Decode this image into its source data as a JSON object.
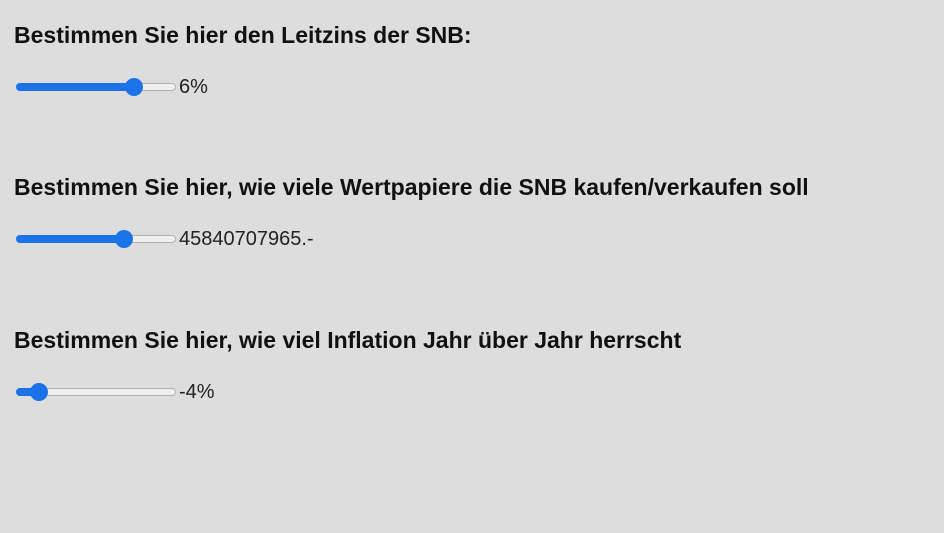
{
  "colors": {
    "background": "#dddddd",
    "accent": "#1a73e8",
    "track": "#efefef",
    "text": "#111111"
  },
  "controls": [
    {
      "heading": "Bestimmen Sie hier den Leitzins der SNB:",
      "value_label": "6%",
      "slider_position": 0.77
    },
    {
      "heading": "Bestimmen Sie hier, wie viele Wertpapiere die SNB kaufen/verkaufen soll",
      "value_label": "45840707965.-",
      "slider_position": 0.7
    },
    {
      "heading": "Bestimmen Sie hier, wie viel Inflation Jahr über Jahr herrscht",
      "value_label": "-4%",
      "slider_position": 0.1
    }
  ]
}
